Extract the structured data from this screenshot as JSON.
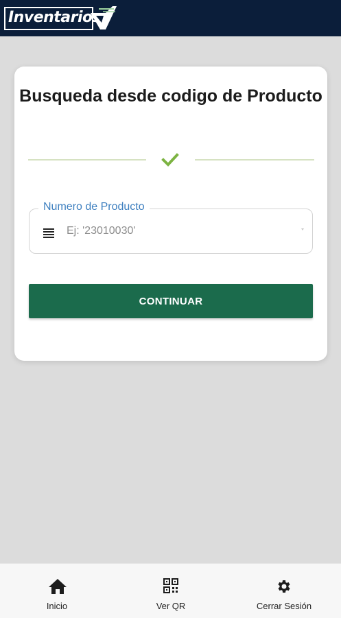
{
  "header": {
    "logo_text": "Inventarios"
  },
  "card": {
    "title": "Busqueda desde codigo de Producto",
    "field": {
      "label": "Numero de Producto",
      "placeholder": "Ej: '23010030'",
      "icon": "list-icon"
    },
    "continue_label": "CONTINUAR"
  },
  "bottom_nav": {
    "items": [
      {
        "label": "Inicio",
        "icon": "home-icon"
      },
      {
        "label": "Ver QR",
        "icon": "qr-code-icon"
      },
      {
        "label": "Cerrar Sesión",
        "icon": "gear-icon"
      }
    ]
  },
  "colors": {
    "header_bg": "#0b1e3a",
    "primary_button": "#1b6b4c",
    "label_blue": "#3d7fbf",
    "check_green": "#7cb342"
  }
}
